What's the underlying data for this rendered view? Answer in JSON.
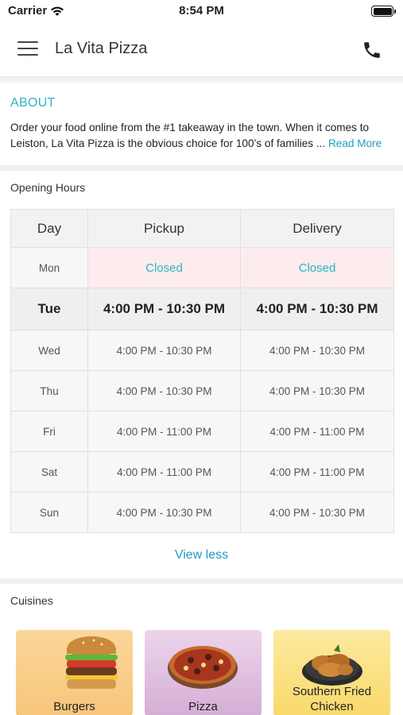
{
  "status_bar": {
    "carrier": "Carrier",
    "time": "8:54 PM"
  },
  "header": {
    "title": "La Vita Pizza",
    "menu_icon": "hamburger-menu-icon",
    "phone_icon": "phone-icon"
  },
  "about": {
    "title": "ABOUT",
    "text": "Order your food online from the #1 takeaway in the town. When it comes to Leiston, La Vita Pizza is the obvious choice for 100’s of families ... ",
    "read_more": "Read More"
  },
  "opening_hours": {
    "title": "Opening Hours",
    "columns": [
      "Day",
      "Pickup",
      "Delivery"
    ],
    "rows": [
      {
        "day": "Mon",
        "pickup": "Closed",
        "delivery": "Closed"
      },
      {
        "day": "Tue",
        "pickup": "4:00 PM - 10:30 PM",
        "delivery": "4:00 PM - 10:30 PM"
      },
      {
        "day": "Wed",
        "pickup": "4:00 PM - 10:30 PM",
        "delivery": "4:00 PM - 10:30 PM"
      },
      {
        "day": "Thu",
        "pickup": "4:00 PM - 10:30 PM",
        "delivery": "4:00 PM - 10:30 PM"
      },
      {
        "day": "Fri",
        "pickup": "4:00 PM - 11:00 PM",
        "delivery": "4:00 PM - 11:00 PM"
      },
      {
        "day": "Sat",
        "pickup": "4:00 PM - 11:00 PM",
        "delivery": "4:00 PM - 11:00 PM"
      },
      {
        "day": "Sun",
        "pickup": "4:00 PM - 10:30 PM",
        "delivery": "4:00 PM - 10:30 PM"
      }
    ],
    "view_less": "View less"
  },
  "cuisines": {
    "title": "Cuisines",
    "items": [
      {
        "label": "Burgers"
      },
      {
        "label": "Pizza"
      },
      {
        "label": "Southern Fried Chicken"
      }
    ]
  },
  "colors": {
    "accent": "#2bb5c2",
    "link": "#1e9cc3",
    "closed_bg": "#fdecee"
  }
}
